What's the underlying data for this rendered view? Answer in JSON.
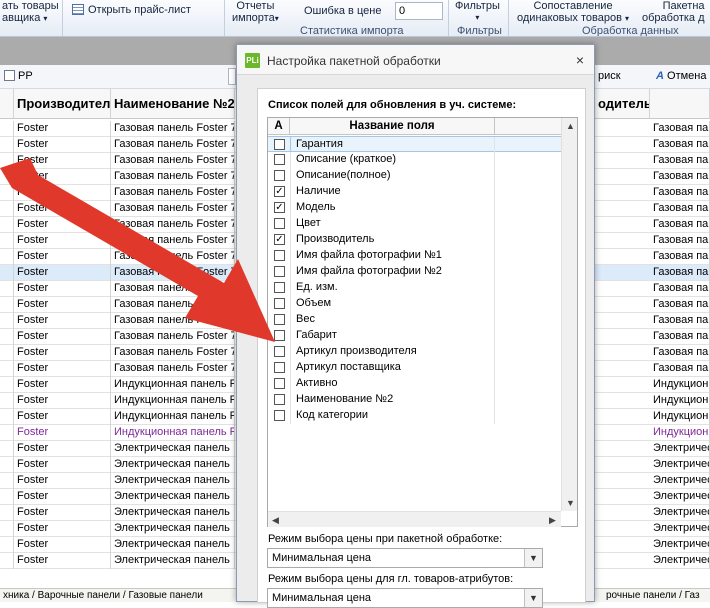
{
  "ribbon": {
    "items": [
      {
        "name": "ribbon-zagruzit-tovary",
        "line1": "ать товары",
        "line2": "авщика",
        "caret": "▾"
      },
      {
        "name": "ribbon-open-pricelist",
        "line1": "Открыть прайс-лист",
        "line2": ""
      },
      {
        "name": "ribbon-otchety-importa",
        "line1": "Отчеты",
        "line2": "импорта",
        "caret": "▾"
      },
      {
        "name": "ribbon-oshibka-v-cene",
        "line1": "Ошибка в цене",
        "line2": ""
      },
      {
        "name": "ribbon-filtry",
        "line1": "Фильтры",
        "line2": "",
        "caret": "▾"
      },
      {
        "name": "ribbon-sopostavlenie",
        "line1": "Сопоставление",
        "line2": "одинаковых товаров",
        "caret": "▾"
      },
      {
        "name": "ribbon-paketnaya",
        "line1": "Пакетна",
        "line2": "обработка д"
      }
    ],
    "price_error_value": "0",
    "groups": [
      "Статистика импорта",
      "Фильтры",
      "Обработка данных"
    ]
  },
  "toolbar": {
    "check_label": "PP",
    "search_label": "риск",
    "cancel_label": "Отмена"
  },
  "grid": {
    "headers": [
      "Производитель",
      "Наименование №2",
      "одитель"
    ],
    "rows": [
      {
        "a": "Foster",
        "b": "Газовая панель Foster 7",
        "c": "Газовая панель"
      },
      {
        "a": "Foster",
        "b": "Газовая панель Foster 7",
        "c": "Газовая панель"
      },
      {
        "a": "Foster",
        "b": "Газовая панель Foster 7",
        "c": "Газовая панель"
      },
      {
        "a": "Foster",
        "b": "Газовая панель Foster 7",
        "c": "Газовая панель"
      },
      {
        "a": "Foster",
        "b": "Газовая панель Foster 7",
        "c": "Газовая панель"
      },
      {
        "a": "Foster",
        "b": "Газовая панель Foster 7",
        "c": "Газовая панель"
      },
      {
        "a": "Foster",
        "b": "Газовая панель Foster 7",
        "c": "Газовая панель"
      },
      {
        "a": "Foster",
        "b": "Газовая панель Foster 7",
        "c": "Газовая панель"
      },
      {
        "a": "Foster",
        "b": "Газовая панель Foster 7",
        "c": "Газовая панель"
      },
      {
        "a": "Foster",
        "b": "Газовая панель Foster 7",
        "c": "Газовая панель"
      },
      {
        "a": "Foster",
        "b": "Газовая панель Foster 7",
        "c": "Газовая панель"
      },
      {
        "a": "Foster",
        "b": "Газовая панель Foster 7",
        "c": "Газовая панель"
      },
      {
        "a": "Foster",
        "b": "Газовая панель Foster 7",
        "c": "Газовая панель"
      },
      {
        "a": "Foster",
        "b": "Газовая панель Foster 7",
        "c": "Газовая панель"
      },
      {
        "a": "Foster",
        "b": "Газовая панель Foster 7",
        "c": "Газовая панель"
      },
      {
        "a": "Foster",
        "b": "Газовая панель Foster 7",
        "c": "Газовая панель"
      },
      {
        "a": "Foster",
        "b": "Индукционная панель F",
        "c": "Индукционн"
      },
      {
        "a": "Foster",
        "b": "Индукционная панель F",
        "c": "Индукционн"
      },
      {
        "a": "Foster",
        "b": "Индукционная панель F",
        "c": "Индукционн"
      },
      {
        "a": "Foster",
        "b": "Индукционная панель F",
        "c": "Индукционн"
      },
      {
        "a": "Foster",
        "b": "Электрическая панель",
        "c": "Электричес"
      },
      {
        "a": "Foster",
        "b": "Электрическая панель",
        "c": "Электричес"
      },
      {
        "a": "Foster",
        "b": "Электрическая панель",
        "c": "Электричес"
      },
      {
        "a": "Foster",
        "b": "Электрическая панель",
        "c": "Электричес"
      },
      {
        "a": "Foster",
        "b": "Электрическая панель",
        "c": "Электричес"
      },
      {
        "a": "Foster",
        "b": "Электрическая панель",
        "c": "Электричес"
      },
      {
        "a": "Foster",
        "b": "Электрическая панель",
        "c": "Электричес"
      },
      {
        "a": "Foster",
        "b": "Электрическая панель",
        "c": "Электричес"
      }
    ],
    "selected_row": 9,
    "purple_row": 19
  },
  "status": {
    "left": "хника / Варочные панели / Газовые панели",
    "right": "рочные панели / Газ"
  },
  "dialog": {
    "title": "Настройка пакетной обработки",
    "logo": "PLi",
    "close": "×",
    "list_caption": "Список полей для обновления в уч. системе:",
    "col_a": "А",
    "col_name": "Название поля",
    "fields": [
      {
        "label": "Гарантия",
        "checked": false
      },
      {
        "label": "Описание (краткое)",
        "checked": false
      },
      {
        "label": "Описание(полное)",
        "checked": false
      },
      {
        "label": "Наличие",
        "checked": true
      },
      {
        "label": "Модель",
        "checked": true
      },
      {
        "label": "Цвет",
        "checked": false
      },
      {
        "label": "Производитель",
        "checked": true
      },
      {
        "label": "Имя файла фотографии №1",
        "checked": false
      },
      {
        "label": "Имя файла фотографии №2",
        "checked": false
      },
      {
        "label": "Ед. изм.",
        "checked": false
      },
      {
        "label": "Объем",
        "checked": false
      },
      {
        "label": "Вес",
        "checked": false
      },
      {
        "label": "Габарит",
        "checked": false
      },
      {
        "label": "Артикул производителя",
        "checked": false
      },
      {
        "label": "Артикул поставщика",
        "checked": false
      },
      {
        "label": "Активно",
        "checked": false
      },
      {
        "label": "Наименование №2",
        "checked": false
      },
      {
        "label": "Код категории",
        "checked": false
      }
    ],
    "price_mode_label": "Режим выбора цены при пакетной обработке:",
    "price_mode_value": "Минимальная цена",
    "attr_mode_label": "Режим выбора цены для гл. товаров-атрибутов:",
    "attr_mode_value": "Минимальная цена"
  },
  "colors": {
    "arrow": "#e0382b",
    "selection": "#dcebfa",
    "purple_text": "#7d2a94",
    "logo": "#6bb82a"
  }
}
